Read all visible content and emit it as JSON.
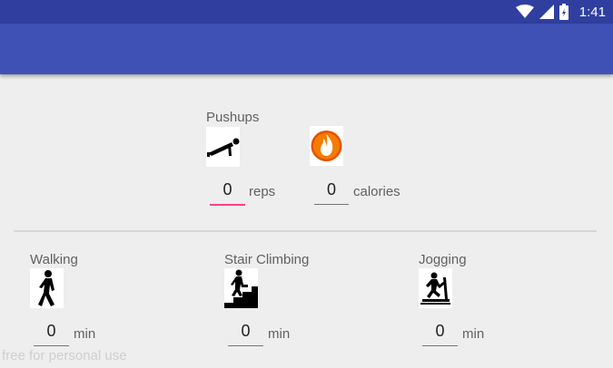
{
  "status_bar": {
    "time": "1:41",
    "icons": [
      "wifi-icon",
      "cellular-signal-icon",
      "battery-icon"
    ]
  },
  "pushups": {
    "title": "Pushups",
    "icon": "pushup-icon",
    "reps_value": "0",
    "reps_unit": "reps",
    "calories_icon": "flame-icon",
    "calories_value": "0",
    "calories_unit": "calories"
  },
  "activities": [
    {
      "title": "Walking",
      "icon": "walking-icon",
      "value": "0",
      "unit": "min"
    },
    {
      "title": "Stair Climbing",
      "icon": "stair-climbing-icon",
      "value": "0",
      "unit": "min"
    },
    {
      "title": "Jogging",
      "icon": "treadmill-jogging-icon",
      "value": "0",
      "unit": "min"
    }
  ],
  "watermark": "free for personal use",
  "colors": {
    "status_bar": "#303f9f",
    "app_bar": "#3f51b5",
    "accent": "#ff4081",
    "background": "#eeeeee"
  }
}
